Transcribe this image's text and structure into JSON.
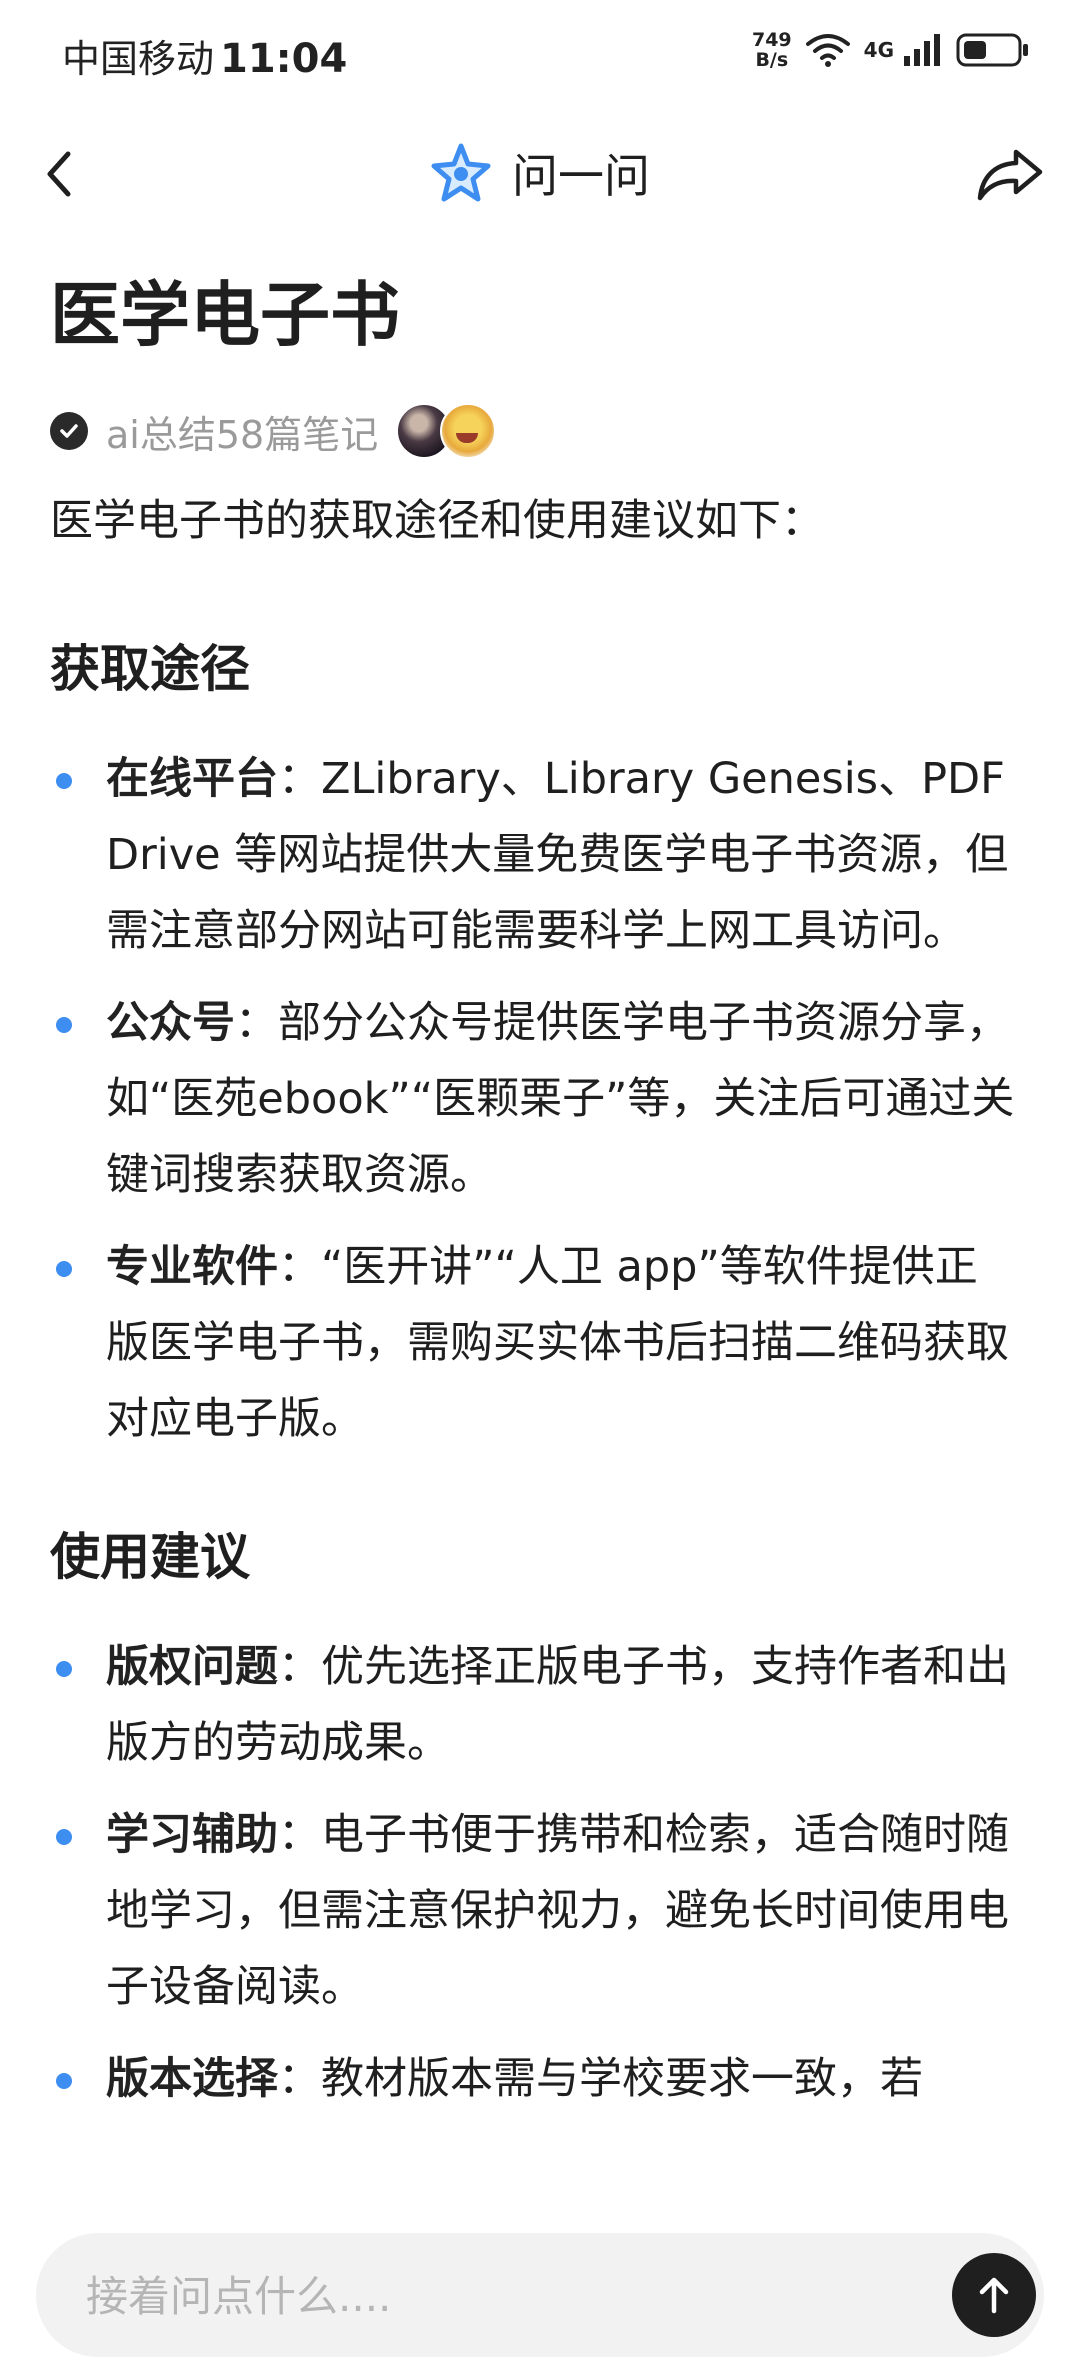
{
  "status_bar": {
    "carrier": "中国移动",
    "time": "11:04",
    "speed_value": "749",
    "speed_unit": "B/s",
    "network": "4G",
    "icons": [
      "wifi-icon",
      "signal-icon",
      "battery-icon"
    ]
  },
  "nav": {
    "title": "问一问",
    "icons": [
      "back-icon",
      "star-logo-icon",
      "share-icon"
    ],
    "accent_color": "#3d8ef0"
  },
  "page": {
    "title": "医学电子书",
    "meta": "ai总结58篇笔记",
    "intro": "医学电子书的获取途径和使用建议如下："
  },
  "sections": [
    {
      "heading": "获取途径",
      "items": [
        {
          "term": "在线平台",
          "text": "：ZLibrary、Library Genesis、PDF Drive 等网站提供大量免费医学电子书资源，但需注意部分网站可能需要科学上网工具访问。"
        },
        {
          "term": "公众号",
          "text": "：部分公众号提供医学电子书资源分享，如“医苑ebook”“医颗栗子”等，关注后可通过关键词搜索获取资源。"
        },
        {
          "term": "专业软件",
          "text": "：“医开讲”“人卫 app”等软件提供正版医学电子书，需购买实体书后扫描二维码获取对应电子版。"
        }
      ]
    },
    {
      "heading": "使用建议",
      "items": [
        {
          "term": "版权问题",
          "text": "：优先选择正版电子书，支持作者和出版方的劳动成果。"
        },
        {
          "term": "学习辅助",
          "text": "：电子书便于携带和检索，适合随时随地学习，但需注意保护视力，避免长时间使用电子设备阅读。"
        },
        {
          "term": "版本选择",
          "text": "：教材版本需与学校要求一致，若"
        }
      ]
    }
  ],
  "input": {
    "placeholder": "接着问点什么....",
    "value": ""
  },
  "colors": {
    "bullet": "#3d8ef0",
    "send_button": "#1f1f1f",
    "input_background": "#f2f2f2"
  }
}
